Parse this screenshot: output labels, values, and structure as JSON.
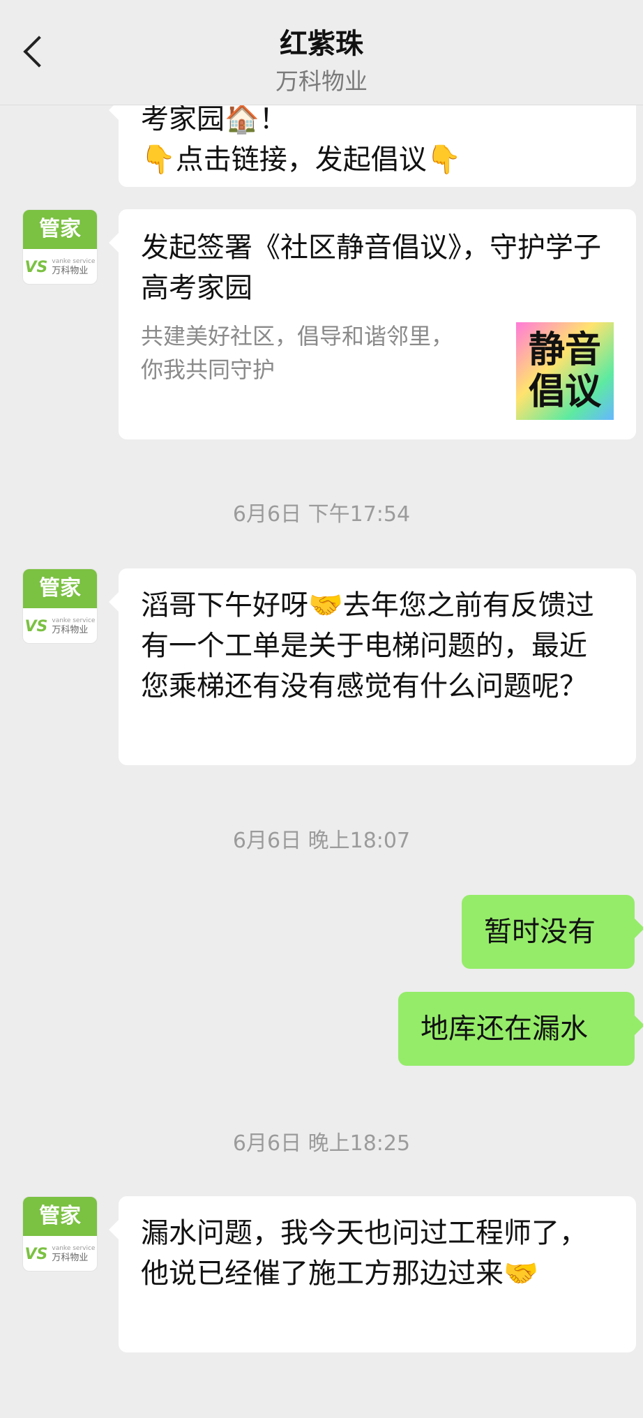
{
  "header": {
    "title": "红紫珠",
    "subtitle": "万科物业"
  },
  "avatar": {
    "label": "管家",
    "brand_en": "vanke service",
    "brand_cn": "万科物业",
    "logo": "VS"
  },
  "messages": {
    "partial": {
      "line1": "考家园🏠！",
      "line2": "👇点击链接，发起倡议👇"
    },
    "link_card": {
      "title": "发起签署《社区静音倡议》，守护学子高考家园",
      "desc": "共建美好社区，倡导和谐邻里，你我共同守护",
      "thumb_line1": "静音",
      "thumb_line2": "倡议"
    },
    "time1": "6月6日 下午17:54",
    "msg1": "滔哥下午好呀🤝去年您之前有反馈过有一个工单是关于电梯问题的，最近您乘梯还有没有感觉有什么问题呢？",
    "time2": "6月6日 晚上18:07",
    "reply1": "暂时没有",
    "reply2": "地库还在漏水",
    "time3": "6月6日 晚上18:25",
    "msg2": "漏水问题，我今天也问过工程师了，他说已经催了施工方那边过来🤝"
  },
  "colors": {
    "background": "#ededed",
    "bubble_left": "#ffffff",
    "bubble_right": "#95ec69",
    "avatar_green": "#7bc142"
  }
}
